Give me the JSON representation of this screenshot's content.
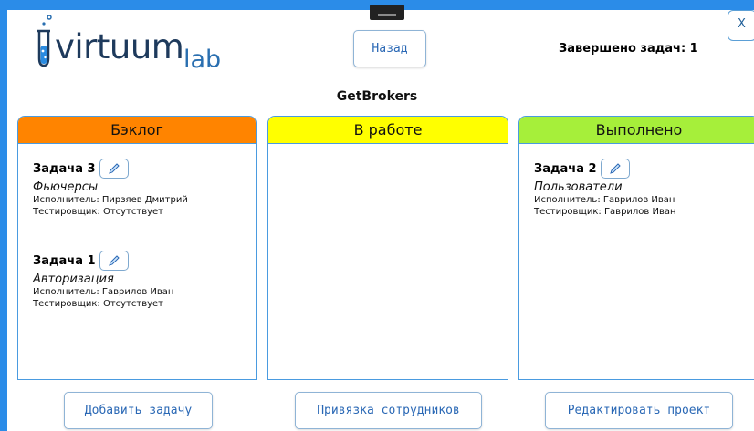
{
  "header": {
    "logo_word": "virtuum",
    "logo_sub": "lab",
    "back_label": "Назад",
    "completed_text": "Завершено задач: 1",
    "close_label": "X"
  },
  "project": {
    "title": "GetBrokers"
  },
  "columns": [
    {
      "title": "Бэклог",
      "color": "#ff8400",
      "tasks": [
        {
          "title": "Задача 3",
          "name": "Фьючерсы",
          "assignee": "Исполнитель: Пирзяев Дмитрий",
          "tester": "Тестировщик: Отсутствует"
        },
        {
          "title": "Задача 1",
          "name": "Авторизация",
          "assignee": "Исполнитель: Гаврилов Иван",
          "tester": "Тестировщик: Отсутствует"
        }
      ]
    },
    {
      "title": "В работе",
      "color": "#ffff00",
      "tasks": []
    },
    {
      "title": "Выполнено",
      "color": "#a6ef3a",
      "tasks": [
        {
          "title": "Задача 2",
          "name": "Пользователи",
          "assignee": "Исполнитель: Гаврилов Иван",
          "tester": "Тестировщик: Гаврилов Иван"
        }
      ]
    }
  ],
  "footer": {
    "add_task": "Добавить задачу",
    "bind_staff": "Привязка сотрудников",
    "edit_project": "Редактировать проект"
  },
  "colors": {
    "accent": "#2b8ce8",
    "border": "#4a9be0",
    "button_text": "#2a68b5"
  }
}
